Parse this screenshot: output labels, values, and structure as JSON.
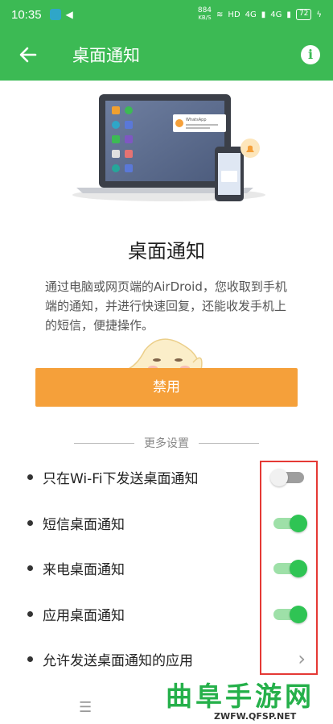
{
  "status_bar": {
    "time": "10:35",
    "net_speed_value": "884",
    "net_speed_unit": "KB/S",
    "hd_label": "HD",
    "signal_1": "4G",
    "signal_2": "4G",
    "battery": "72"
  },
  "app_bar": {
    "title": "桌面通知",
    "back_icon": "arrow-left-icon",
    "info_icon": "info-icon"
  },
  "illustration": {
    "popup_title": "WhatsApp"
  },
  "content": {
    "heading": "桌面通知",
    "description": "通过电脑或网页端的AirDroid，您收取到手机端的通知，并进行快速回复，还能收发手机上的短信，便捷操作。",
    "disable_button": "禁用",
    "more_settings": "更多设置"
  },
  "settings": [
    {
      "label": "只在Wi-Fi下发送桌面通知",
      "control": "toggle",
      "on": false
    },
    {
      "label": "短信桌面通知",
      "control": "toggle",
      "on": true
    },
    {
      "label": "来电桌面通知",
      "control": "toggle",
      "on": true
    },
    {
      "label": "应用桌面通知",
      "control": "toggle",
      "on": true
    },
    {
      "label": "允许发送桌面通知的应用",
      "control": "chevron"
    }
  ],
  "nav": {
    "menu_icon": "menu-icon"
  },
  "watermark": {
    "text": "曲阜手游网",
    "url": "ZWFW.QFSP.NET"
  },
  "colors": {
    "brand_green": "#3cba54",
    "button_orange": "#f5a03a",
    "toggle_on": "#2fc454",
    "highlight_red": "#e53935"
  }
}
